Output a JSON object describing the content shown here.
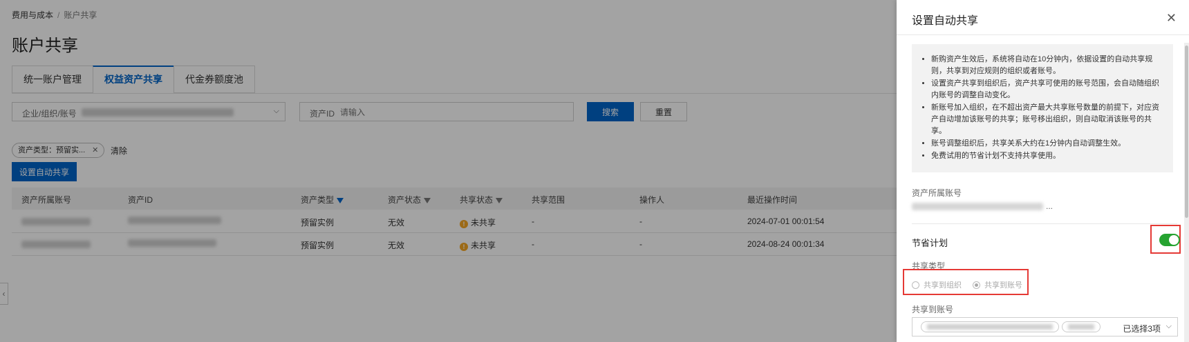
{
  "breadcrumb": {
    "parent": "费用与成本",
    "separator": "/",
    "current": "账户共享"
  },
  "page_title": "账户共享",
  "tabs": [
    {
      "label": "统一账户管理",
      "active": false
    },
    {
      "label": "权益资产共享",
      "active": true
    },
    {
      "label": "代金券额度池",
      "active": false
    }
  ],
  "filters": {
    "org_label": "企业/组织/账号",
    "asset_id_label": "资产ID",
    "asset_id_placeholder": "请输入",
    "search_button": "搜索",
    "reset_button": "重置"
  },
  "active_filter_chip": "资产类型：预留实...",
  "clear_label": "清除",
  "auto_share_button": "设置自动共享",
  "table": {
    "columns": [
      "资产所属账号",
      "资产ID",
      "资产类型",
      "资产状态",
      "共享状态",
      "共享范围",
      "操作人",
      "最近操作时间"
    ],
    "rows": [
      {
        "asset_type": "预留实例",
        "asset_status": "无效",
        "share_status": "未共享",
        "share_scope": "-",
        "operator": "-",
        "last_time": "2024-07-01 00:01:54"
      },
      {
        "asset_type": "预留实例",
        "asset_status": "无效",
        "share_status": "未共享",
        "share_scope": "-",
        "operator": "-",
        "last_time": "2024-08-24 00:01:34"
      }
    ]
  },
  "drawer": {
    "title": "设置自动共享",
    "notes": [
      "新购资产生效后，系统将自动在10分钟内，依据设置的自动共享规则，共享到对应规则的组织或者账号。",
      "设置资产共享到组织后，资产共享可使用的账号范围，会自动随组织内账号的调整自动变化。",
      "新账号加入组织，在不超出资产最大共享账号数量的前提下，对应资产自动增加该账号的共享；账号移出组织，则自动取消该账号的共享。",
      "账号调整组织后，共享关系大约在1分钟内自动调整生效。",
      "免费试用的节省计划不支持共享使用。"
    ],
    "owner_label": "资产所属账号",
    "owner_suffix": "...",
    "plan_label": "节省计划",
    "plan_enabled": true,
    "share_type_label": "共享类型",
    "share_type_options": [
      "共享到组织",
      "共享到账号"
    ],
    "share_type_selected": "共享到账号",
    "share_account_label": "共享到账号",
    "selected_count": "已选择3项"
  },
  "colors": {
    "primary": "#0064c8",
    "toggle_on": "#26a331",
    "highlight": "#e53935",
    "warning": "#f5a623"
  }
}
